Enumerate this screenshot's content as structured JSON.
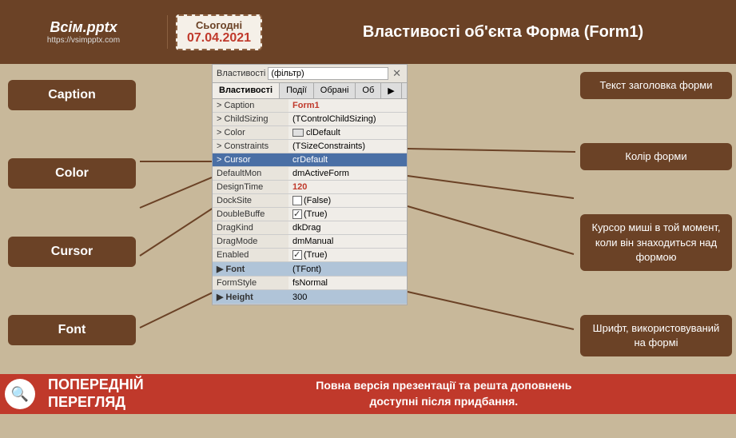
{
  "header": {
    "logo_title": "Всім.pptx",
    "logo_url": "https://vsimpptx.com",
    "date_label": "Сьогодні",
    "date_value": "07.04.2021",
    "title": "Властивості об'єкта Форма (Form1)"
  },
  "left_labels": [
    {
      "id": "caption",
      "text": "Caption"
    },
    {
      "id": "color",
      "text": "Color"
    },
    {
      "id": "cursor",
      "text": "Cursor"
    },
    {
      "id": "font",
      "text": "Font"
    }
  ],
  "props_panel": {
    "filter_label": "Властивості",
    "filter_placeholder": "(фільтр)",
    "tabs": [
      "Властивості",
      "Події",
      "Обрані",
      "Об",
      "▶"
    ],
    "rows": [
      {
        "name": "Caption",
        "value": "Form1",
        "bold": true,
        "type": "normal"
      },
      {
        "name": "ChildSizing",
        "value": "(TControlChildSizing)",
        "type": "expandable"
      },
      {
        "name": "Color",
        "value": "clDefault",
        "type": "color"
      },
      {
        "name": "Constraints",
        "value": "(TSizeConstraints)",
        "type": "expandable"
      },
      {
        "name": "Cursor",
        "value": "crDefault",
        "type": "normal",
        "selected": true
      },
      {
        "name": "DefaultMon",
        "value": "dmActiveForm",
        "type": "normal"
      },
      {
        "name": "DesignTime",
        "value": "120",
        "type": "bold-val"
      },
      {
        "name": "DockSite",
        "value": "(False)",
        "type": "checkbox"
      },
      {
        "name": "DoubleBuffe",
        "value": "(True)",
        "type": "checkbox-checked"
      },
      {
        "name": "DragKind",
        "value": "dkDrag",
        "type": "normal"
      },
      {
        "name": "DragMode",
        "value": "dmManual",
        "type": "normal"
      },
      {
        "name": "Enabled",
        "value": "(True)",
        "type": "checkbox-checked"
      },
      {
        "name": "Font",
        "value": "(TFont)",
        "type": "expandable-arrow"
      },
      {
        "name": "FormStyle",
        "value": "fsNormal",
        "type": "normal"
      },
      {
        "name": "Height",
        "value": "300",
        "type": "normal",
        "arrow": true
      }
    ]
  },
  "right_descs": [
    {
      "id": "caption-desc",
      "text": "Текст заголовка форми"
    },
    {
      "id": "color-desc",
      "text": "Колір форми"
    },
    {
      "id": "cursor-desc",
      "text": "Курсор миші в той момент, коли він знаходиться над формою"
    },
    {
      "id": "font-desc",
      "text": "Шрифт, використовуваний на формі"
    }
  ],
  "footer": {
    "icon": "🔍",
    "left_text_line1": "ПОПЕРЕДНІЙ",
    "left_text_line2": "ПЕРЕГЛЯД",
    "center_text": "Повна версія презентації та решта доповнень\nдоступні після придбання."
  }
}
